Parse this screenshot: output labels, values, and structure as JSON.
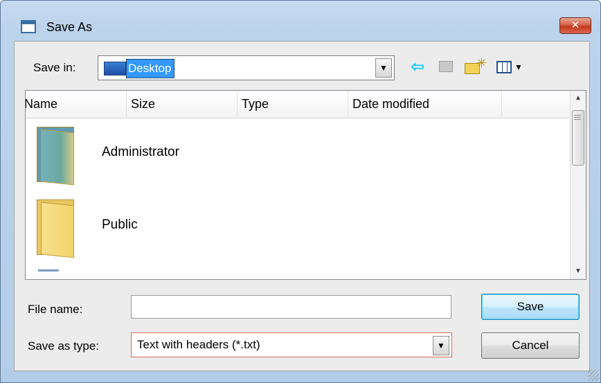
{
  "window": {
    "title": "Save As",
    "close_label": "✕"
  },
  "toolbar": {
    "save_in_label": "Save in:",
    "save_in_value": "Desktop",
    "icons": [
      "back-arrow-icon",
      "up-folder-icon",
      "new-folder-icon",
      "view-menu-icon"
    ]
  },
  "file_list": {
    "columns": [
      "Name",
      "Size",
      "Type",
      "Date modified"
    ],
    "items": [
      {
        "name": "Administrator",
        "icon": "user-folder-icon"
      },
      {
        "name": "Public",
        "icon": "folder-icon"
      }
    ]
  },
  "form": {
    "file_name_label": "File name:",
    "file_name_value": "",
    "save_as_type_label": "Save as type:",
    "save_as_type_value": "Text with headers (*.txt)"
  },
  "buttons": {
    "save": "Save",
    "cancel": "Cancel"
  },
  "colors": {
    "selection": "#3399ff",
    "close_button": "#c2381d",
    "default_button_border": "#3c7fb1"
  }
}
